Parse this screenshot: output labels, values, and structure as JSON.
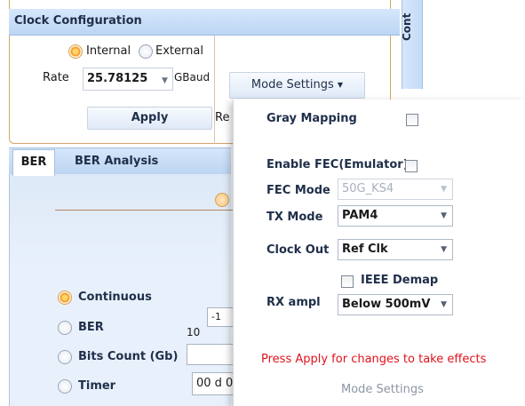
{
  "clock_config": {
    "title": "Clock Configuration",
    "source_options": [
      {
        "label": "Internal",
        "selected": true
      },
      {
        "label": "External",
        "selected": false
      }
    ],
    "rate_label": "Rate",
    "rate_value": "25.78125",
    "rate_unit": "GBaud",
    "apply_label": "Apply",
    "mode_settings_label": "Mode Settings",
    "truncated_label": "Re"
  },
  "right_panel_label": "Cont",
  "tabs": [
    {
      "label": "BER",
      "active": true
    },
    {
      "label": "BER Analysis",
      "active": false
    }
  ],
  "ber": {
    "modes": [
      {
        "label": "Continuous",
        "selected": true
      },
      {
        "label": "BER",
        "selected": false
      },
      {
        "label": "Bits Count (Gb)",
        "selected": false
      },
      {
        "label": "Timer",
        "selected": false
      }
    ],
    "ber_base": "10",
    "ber_exponent": "-1",
    "bits_count_value": "",
    "timer_value": "00 d 0"
  },
  "mode_settings": {
    "gray_mapping_label": "Gray Mapping",
    "gray_mapping_checked": false,
    "enable_fec_label": "Enable FEC(Emulator)",
    "enable_fec_checked": false,
    "fec_mode_label": "FEC Mode",
    "fec_mode_value": "50G_KS4",
    "tx_mode_label": "TX Mode",
    "tx_mode_value": "PAM4",
    "clock_out_label": "Clock Out",
    "clock_out_value": "Ref Clk",
    "ieee_demap_label": "IEEE Demap",
    "ieee_demap_checked": false,
    "rx_ampl_label": "RX ampl",
    "rx_ampl_value": "Below 500mV",
    "warning": "Press Apply for changes to take effects",
    "footer": "Mode Settings"
  },
  "colors": {
    "accent_orange": "#f59e2e",
    "warning_red": "#e0121c",
    "header_blue": "#bcd6f4"
  }
}
